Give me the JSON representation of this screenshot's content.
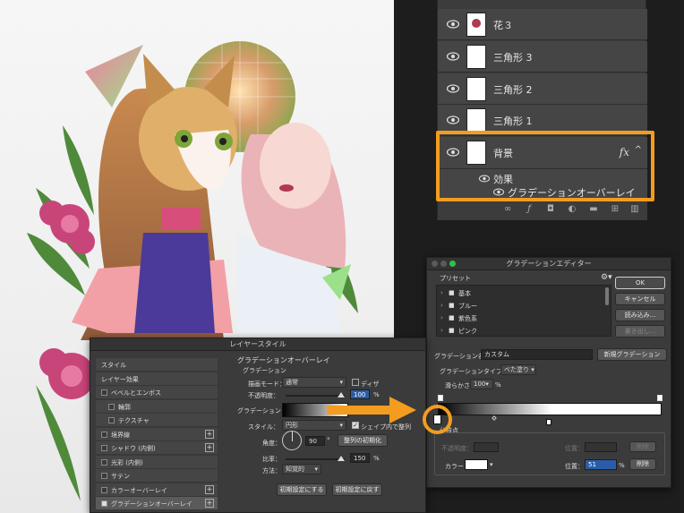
{
  "layers_panel": {
    "rows": [
      {
        "name": "花３"
      },
      {
        "name": "三角形 3"
      },
      {
        "name": "三角形 2"
      },
      {
        "name": "三角形 1"
      },
      {
        "name": "背景"
      }
    ],
    "fx_label": "fx",
    "effects_label": "効果",
    "effect_item": "グラデーションオーバーレイ"
  },
  "gradient_editor": {
    "title": "グラデーションエディター",
    "presets_label": "プリセット",
    "folders": [
      "基本",
      "ブルー",
      "紫色系",
      "ピンク"
    ],
    "ok": "OK",
    "cancel": "キャンセル",
    "load": "読み込み...",
    "save": "書き出し...",
    "name_label": "グラデーション名：",
    "name_value": "カスタム",
    "new_gradient": "新規グラデーション",
    "type_label": "グラデーションタイプ：",
    "type_value": "べた塗り",
    "smoothness_label": "滑らかさ：",
    "smoothness_value": "100",
    "percent": "%",
    "stops_label": "分岐点",
    "opacity_label": "不透明度：",
    "location_label": "位置：",
    "delete": "削除",
    "color_label": "カラー：",
    "location_value": "51"
  },
  "layer_style": {
    "title": "レイヤースタイル",
    "sidebar": [
      {
        "label": "スタイル",
        "checkbox": false,
        "plus": false,
        "active": false
      },
      {
        "label": "レイヤー効果",
        "checkbox": false,
        "plus": false,
        "active": false
      },
      {
        "label": "ベベルとエンボス",
        "checkbox": true,
        "plus": false,
        "active": false
      },
      {
        "label": "輪郭",
        "checkbox": true,
        "plus": false,
        "active": false,
        "indent": true
      },
      {
        "label": "テクスチャ",
        "checkbox": true,
        "plus": false,
        "active": false,
        "indent": true
      },
      {
        "label": "境界線",
        "checkbox": true,
        "plus": true,
        "active": false
      },
      {
        "label": "シャドウ (内側)",
        "checkbox": true,
        "plus": true,
        "active": false
      },
      {
        "label": "光彩 (内側)",
        "checkbox": true,
        "plus": false,
        "active": false
      },
      {
        "label": "サテン",
        "checkbox": true,
        "plus": false,
        "active": false
      },
      {
        "label": "カラーオーバーレイ",
        "checkbox": true,
        "plus": true,
        "active": false
      },
      {
        "label": "グラデーションオーバーレイ",
        "checkbox": true,
        "plus": true,
        "active": true
      }
    ],
    "section_title": "グラデーションオーバーレイ",
    "sub_title": "グラデーション",
    "blend_label": "描画モード：",
    "blend_value": "通常",
    "dither_label": "ディザ",
    "opacity_label": "不透明度：",
    "opacity_value": "100",
    "percent": "%",
    "gradient_label": "グラデーション：",
    "style_label": "スタイル：",
    "style_value": "円形",
    "align_label": "シェイプ内で整列",
    "angle_label": "角度：",
    "angle_value": "90",
    "degree": "°",
    "reset_align": "整列の初期化",
    "scale_label": "比率：",
    "scale_value": "150",
    "method_label": "方法：",
    "method_value": "知覚的",
    "make_default": "初期設定にする",
    "reset_default": "初期設定に戻す"
  },
  "colors": {
    "accent": "#f39c1f",
    "panel": "#3b3b3b",
    "highlight_blue": "#2a5da8"
  }
}
